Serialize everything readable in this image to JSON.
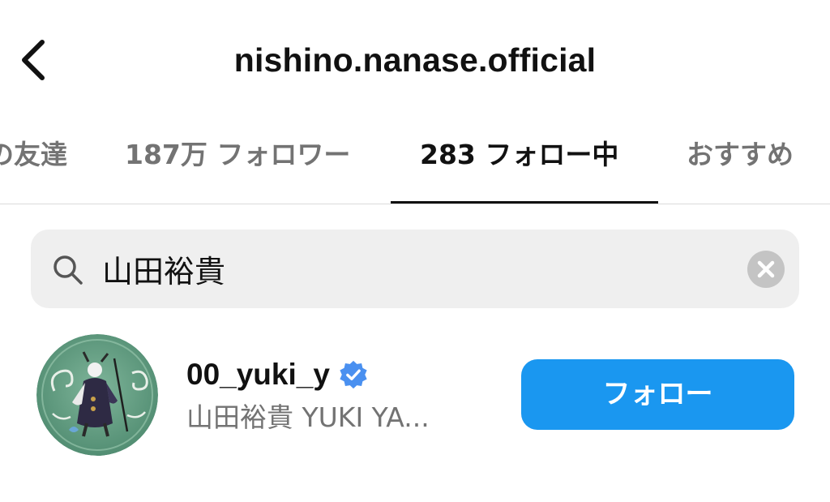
{
  "header": {
    "title": "nishino.nanase.official",
    "back_icon": "chevron-left-icon"
  },
  "tabs": [
    {
      "label": "の友達",
      "active": false
    },
    {
      "label": "187万 フォロワー",
      "active": false
    },
    {
      "label": "283 フォロー中",
      "active": true
    },
    {
      "label": "おすすめ",
      "active": false
    }
  ],
  "search": {
    "value": "山田裕貴",
    "search_icon": "search-icon",
    "clear_icon": "clear-icon"
  },
  "results": [
    {
      "username": "00_yuki_y",
      "verified": true,
      "full_name": "山田裕貴 YUKI YA...",
      "button_label": "フォロー",
      "avatar_icon": "avatar-image"
    }
  ],
  "colors": {
    "accent": "#1a97f0",
    "verified": "#4a90f0",
    "secondary_text": "#737373",
    "search_bg": "#efefef"
  }
}
